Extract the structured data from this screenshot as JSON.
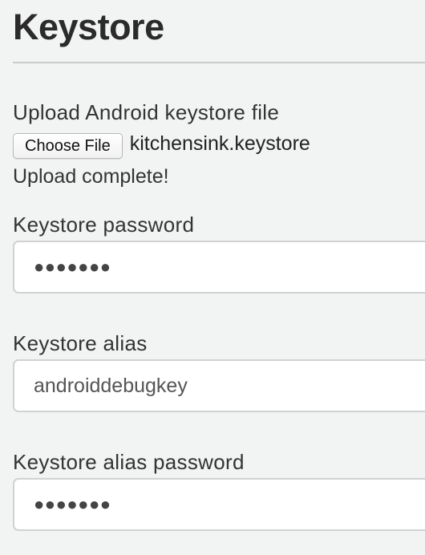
{
  "section": {
    "title": "Keystore"
  },
  "upload": {
    "label": "Upload Android keystore file",
    "button_label": "Choose File",
    "file_name": "kitchensink.keystore",
    "status": "Upload complete!"
  },
  "fields": {
    "keystore_password": {
      "label": "Keystore password",
      "value": "●●●●●●●"
    },
    "keystore_alias": {
      "label": "Keystore alias",
      "value": "androiddebugkey"
    },
    "alias_password": {
      "label": "Keystore alias password",
      "value": "●●●●●●●"
    }
  }
}
